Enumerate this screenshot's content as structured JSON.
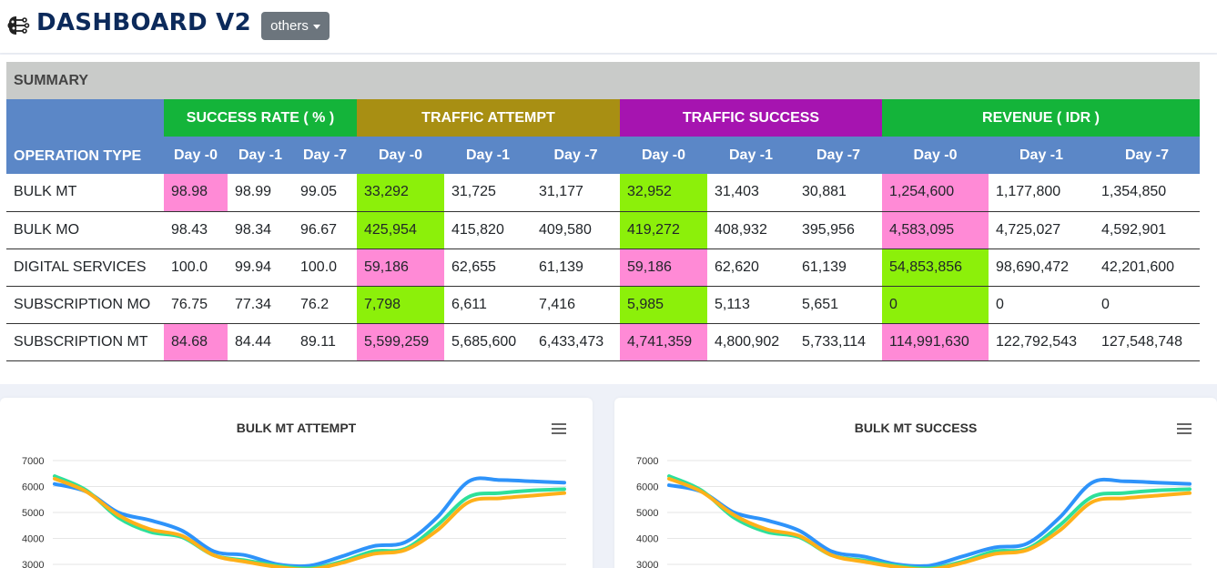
{
  "header": {
    "title": "DASHBOARD V2 .0",
    "dropdown_label": "others"
  },
  "summary": {
    "title": "SUMMARY",
    "op_header": "OPERATION TYPE",
    "groups": [
      "SUCCESS RATE ( % )",
      "TRAFFIC ATTEMPT",
      "TRAFFIC SUCCESS",
      "REVENUE ( IDR )"
    ],
    "days": [
      "Day -0",
      "Day -1",
      "Day -7"
    ],
    "colors": {
      "success_rate": "#14b43a",
      "traffic_attempt": "#a88f13",
      "traffic_success": "#a614b0",
      "revenue": "#14b43a",
      "header_blue": "#5b87c7",
      "highlight_pink": "#ff8ad6",
      "highlight_green": "#8cf00a"
    },
    "rows": [
      {
        "op": "BULK MT",
        "cells": [
          "98.98",
          "98.99",
          "99.05",
          "33,292",
          "31,725",
          "31,177",
          "32,952",
          "31,403",
          "30,881",
          "1,254,600",
          "1,177,800",
          "1,354,850"
        ],
        "highlight": [
          "pink",
          "",
          "",
          "green",
          "",
          "",
          "green",
          "",
          "",
          "pink",
          "",
          ""
        ]
      },
      {
        "op": "BULK MO",
        "cells": [
          "98.43",
          "98.34",
          "96.67",
          "425,954",
          "415,820",
          "409,580",
          "419,272",
          "408,932",
          "395,956",
          "4,583,095",
          "4,725,027",
          "4,592,901"
        ],
        "highlight": [
          "",
          "",
          "",
          "green",
          "",
          "",
          "green",
          "",
          "",
          "pink",
          "",
          ""
        ]
      },
      {
        "op": "DIGITAL SERVICES",
        "cells": [
          "100.0",
          "99.94",
          "100.0",
          "59,186",
          "62,655",
          "61,139",
          "59,186",
          "62,620",
          "61,139",
          "54,853,856",
          "98,690,472",
          "42,201,600"
        ],
        "highlight": [
          "",
          "",
          "",
          "pink",
          "",
          "",
          "pink",
          "",
          "",
          "green",
          "",
          ""
        ]
      },
      {
        "op": "SUBSCRIPTION MO",
        "cells": [
          "76.75",
          "77.34",
          "76.2",
          "7,798",
          "6,611",
          "7,416",
          "5,985",
          "5,113",
          "5,651",
          "0",
          "0",
          "0"
        ],
        "highlight": [
          "",
          "",
          "",
          "green",
          "",
          "",
          "green",
          "",
          "",
          "green",
          "",
          ""
        ]
      },
      {
        "op": "SUBSCRIPTION MT",
        "cells": [
          "84.68",
          "84.44",
          "89.11",
          "5,599,259",
          "5,685,600",
          "6,433,473",
          "4,741,359",
          "4,800,902",
          "5,733,114",
          "114,991,630",
          "122,792,543",
          "127,548,748"
        ],
        "highlight": [
          "pink",
          "",
          "",
          "pink",
          "",
          "",
          "pink",
          "",
          "",
          "pink",
          "",
          ""
        ]
      }
    ]
  },
  "chart_data": [
    {
      "type": "line",
      "title": "BULK MT ATTEMPT",
      "yticks": [
        "7000",
        "6000",
        "5000",
        "4000",
        "3000"
      ],
      "ylim": [
        3000,
        7000
      ],
      "series": [
        {
          "color": "#2e93fa",
          "values": [
            6100,
            5800,
            5000,
            4700,
            4300,
            3500,
            3350,
            3000,
            2950,
            3300,
            3700,
            3850,
            4800,
            6200,
            6250,
            6200,
            6150
          ]
        },
        {
          "color": "#2ee09a",
          "values": [
            6400,
            5850,
            4800,
            4250,
            4050,
            3350,
            3150,
            2950,
            2850,
            3100,
            3500,
            3600,
            4500,
            5600,
            5750,
            5850,
            5900
          ]
        },
        {
          "color": "#feb019",
          "values": [
            6300,
            5800,
            4900,
            4350,
            4100,
            3350,
            3100,
            2900,
            2800,
            3050,
            3400,
            3550,
            4300,
            5400,
            5550,
            5650,
            5750
          ]
        }
      ]
    },
    {
      "type": "line",
      "title": "BULK MT SUCCESS",
      "yticks": [
        "7000",
        "6000",
        "5000",
        "4000",
        "3000"
      ],
      "ylim": [
        3000,
        7000
      ],
      "series": [
        {
          "color": "#2e93fa",
          "values": [
            6050,
            5800,
            5000,
            4700,
            4300,
            3500,
            3300,
            3000,
            2950,
            3300,
            3650,
            3800,
            4800,
            6150,
            6200,
            6150,
            6100
          ]
        },
        {
          "color": "#2ee09a",
          "values": [
            6400,
            5850,
            4800,
            4250,
            4050,
            3350,
            3150,
            2950,
            2850,
            3100,
            3500,
            3600,
            4500,
            5600,
            5750,
            5850,
            5900
          ]
        },
        {
          "color": "#feb019",
          "values": [
            6300,
            5800,
            4900,
            4350,
            4100,
            3350,
            3100,
            2900,
            2800,
            3050,
            3400,
            3550,
            4300,
            5400,
            5550,
            5650,
            5750
          ]
        }
      ]
    }
  ]
}
